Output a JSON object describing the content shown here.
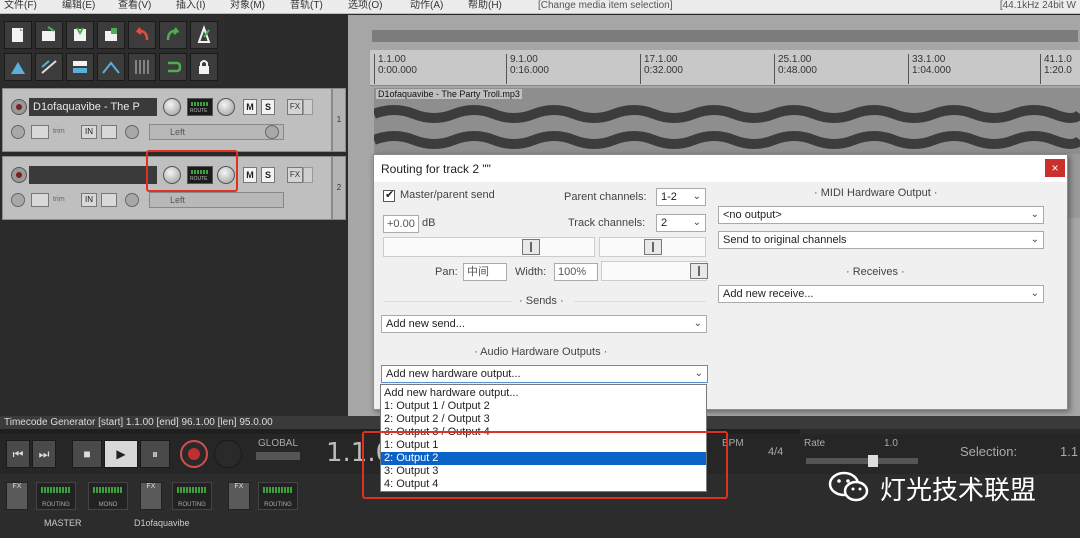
{
  "menubar": {
    "items": [
      {
        "label": "文件(F)"
      },
      {
        "label": "编辑(E)"
      },
      {
        "label": "查看(V)"
      },
      {
        "label": "插入(I)"
      },
      {
        "label": "对象(M)"
      },
      {
        "label": "音轨(T)"
      },
      {
        "label": "选项(O)"
      },
      {
        "label": "动作(A)"
      },
      {
        "label": "帮助(H)"
      }
    ],
    "last_action": "[Change media item selection]",
    "audio_info": "[44.1kHz 24bit W"
  },
  "toolbar": {
    "icons": [
      "new-project-icon",
      "open-project-icon",
      "save-project-icon",
      "project-settings-icon",
      "undo-icon",
      "redo-icon",
      "metronome-icon",
      "grid-icon",
      "ripple-edit-icon",
      "snap-icon",
      "auto-crossfade-icon",
      "envelope-icon",
      "loop-icon",
      "lock-icon"
    ]
  },
  "tracks": [
    {
      "number": "1",
      "name": "D1ofaquavibe - The P",
      "mute": "M",
      "solo": "S",
      "fx": "FX",
      "input": "IN",
      "input_select": "Left",
      "env": "trim",
      "meter_label": "ROUTE"
    },
    {
      "number": "2",
      "name": "",
      "mute": "M",
      "solo": "S",
      "fx": "FX",
      "input": "IN",
      "input_select": "Left",
      "env": "trim",
      "meter_label": "ROUTE"
    }
  ],
  "ruler": {
    "ticks": [
      {
        "measure": "1.1.00",
        "time": "0:00.000"
      },
      {
        "measure": "9.1.00",
        "time": "0:16.000"
      },
      {
        "measure": "17.1.00",
        "time": "0:32.000"
      },
      {
        "measure": "25.1.00",
        "time": "0:48.000"
      },
      {
        "measure": "33.1.00",
        "time": "1:04.000"
      },
      {
        "measure": "41.1.0",
        "time": "1:20.0"
      }
    ]
  },
  "media_item": {
    "label": "D1ofaquavibe - The Party Troll.mp3"
  },
  "routing_dialog": {
    "title": "Routing for track 2 \"\"",
    "close": "×",
    "master_send_label": "Master/parent send",
    "master_send_checked": true,
    "parent_channels_label": "Parent channels:",
    "parent_channels_value": "1-2",
    "track_channels_label": "Track channels:",
    "track_channels_value": "2",
    "volume_value": "+0.00",
    "volume_unit": "dB",
    "pan_label": "Pan:",
    "pan_value": "中间",
    "width_label": "Width:",
    "width_value": "100%",
    "sends_header": "Sends",
    "add_send": "Add new send...",
    "hw_outputs_header": "Audio Hardware Outputs",
    "add_hw_output": "Add new hardware output...",
    "midi_hw_header": "MIDI Hardware Output",
    "midi_output_value": "<no output>",
    "midi_channels_value": "Send to original channels",
    "receives_header": "Receives",
    "add_receive": "Add new receive..."
  },
  "hw_output_list": {
    "options": [
      {
        "label": "Add new hardware output...",
        "selected": false
      },
      {
        "label": "1: Output 1 / Output 2",
        "selected": false
      },
      {
        "label": "2: Output 2 / Output 3",
        "selected": false
      },
      {
        "label": "3: Output 3 / Output 4",
        "selected": false
      },
      {
        "label": "1: Output 1",
        "selected": false
      },
      {
        "label": "2: Output 2",
        "selected": true
      },
      {
        "label": "3: Output 3",
        "selected": false
      },
      {
        "label": "4: Output 4",
        "selected": false
      }
    ]
  },
  "timecode_bar": {
    "text": "Timecode Generator [start] 1.1.00 [end] 96.1.00 [len] 95.0.00"
  },
  "transport": {
    "position": "1.1.0",
    "bpm_label": "BPM",
    "sig": "4/4",
    "rate_label": "Rate",
    "rate_value": "1.0",
    "selection_label": "Selection:",
    "selection_value": "1.1",
    "global_label": "GLOBAL",
    "buttons": [
      "⏮",
      "⏭",
      "■",
      "▶",
      "⏸"
    ]
  },
  "mixer": {
    "master_label": "MASTER",
    "track_label": "D1ofaquavibe",
    "fx": "FX",
    "routing": "ROUTING",
    "mono": "MONO"
  },
  "watermark": {
    "text": "灯光技术联盟"
  },
  "colors": {
    "highlight": "#e03020",
    "selection": "#0a64c8",
    "close": "#c9302c"
  }
}
